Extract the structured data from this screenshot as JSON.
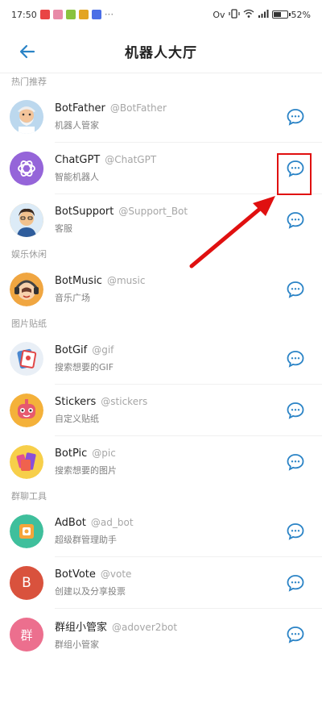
{
  "status": {
    "time": "17:50",
    "network": "Ov",
    "battery": "52%"
  },
  "header": {
    "title": "机器人大厅"
  },
  "sections": [
    {
      "label": "热门推荐",
      "bots": [
        {
          "name": "BotFather",
          "handle": "@BotFather",
          "desc": "机器人管家"
        },
        {
          "name": "ChatGPT",
          "handle": "@ChatGPT",
          "desc": "智能机器人"
        },
        {
          "name": "BotSupport",
          "handle": "@Support_Bot",
          "desc": "客服"
        }
      ]
    },
    {
      "label": "娱乐休闲",
      "bots": [
        {
          "name": "BotMusic",
          "handle": "@music",
          "desc": "音乐广场"
        }
      ]
    },
    {
      "label": "图片贴纸",
      "bots": [
        {
          "name": "BotGif",
          "handle": "@gif",
          "desc": "搜索想要的GIF"
        },
        {
          "name": "Stickers",
          "handle": "@stickers",
          "desc": "自定义贴纸"
        },
        {
          "name": "BotPic",
          "handle": "@pic",
          "desc": "搜索想要的图片"
        }
      ]
    },
    {
      "label": "群聊工具",
      "bots": [
        {
          "name": "AdBot",
          "handle": "@ad_bot",
          "desc": "超级群管理助手"
        },
        {
          "name": "BotVote",
          "handle": "@vote",
          "desc": "创建以及分享投票"
        },
        {
          "name": "群组小管家",
          "handle": "@adover2bot",
          "desc": "群组小管家"
        }
      ]
    }
  ],
  "avatars": {
    "votes_letter": "B",
    "group_letter": "群"
  },
  "colors": {
    "accent": "#2a83c6",
    "annotation": "#e01010"
  }
}
